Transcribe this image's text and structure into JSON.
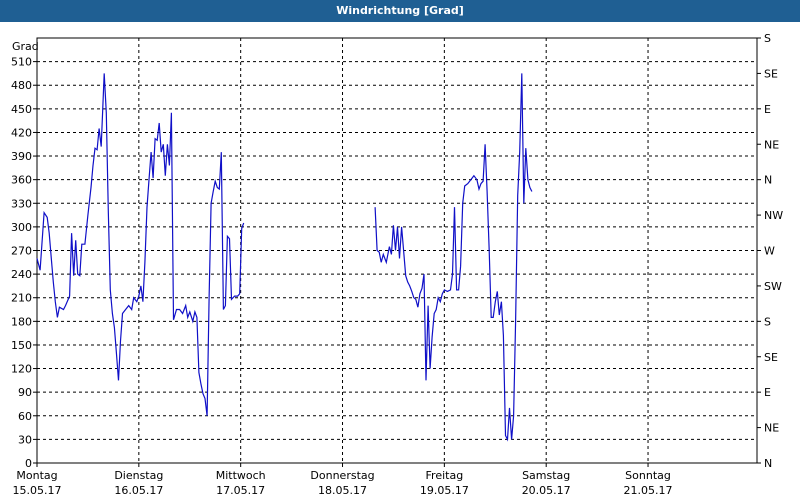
{
  "window": {
    "title": "Windrichtung [Grad]"
  },
  "chart_data": {
    "type": "line",
    "title": "Windrichtung [Grad]",
    "ylabel": "Grad",
    "ylim": [
      0,
      540
    ],
    "y_ticks": [
      0,
      30,
      60,
      90,
      120,
      150,
      180,
      210,
      240,
      270,
      300,
      330,
      360,
      390,
      420,
      450,
      480,
      510
    ],
    "right_axis_ticks": [
      {
        "value": 0,
        "label": "N"
      },
      {
        "value": 45,
        "label": "NE"
      },
      {
        "value": 90,
        "label": "E"
      },
      {
        "value": 135,
        "label": "SE"
      },
      {
        "value": 180,
        "label": "S"
      },
      {
        "value": 225,
        "label": "SW"
      },
      {
        "value": 270,
        "label": "W"
      },
      {
        "value": 315,
        "label": "NW"
      },
      {
        "value": 360,
        "label": "N"
      },
      {
        "value": 405,
        "label": "NE"
      },
      {
        "value": 450,
        "label": "E"
      },
      {
        "value": 495,
        "label": "SE"
      },
      {
        "value": 540,
        "label": "S"
      }
    ],
    "x_range": [
      0,
      7.07
    ],
    "x_ticks": [
      {
        "day": 0,
        "weekday": "Montag",
        "date": "15.05.17"
      },
      {
        "day": 1,
        "weekday": "Dienstag",
        "date": "16.05.17"
      },
      {
        "day": 2,
        "weekday": "Mittwoch",
        "date": "17.05.17"
      },
      {
        "day": 3,
        "weekday": "Donnerstag",
        "date": "18.05.17"
      },
      {
        "day": 4,
        "weekday": "Freitag",
        "date": "19.05.17"
      },
      {
        "day": 5,
        "weekday": "Samstag",
        "date": "20.05.17"
      },
      {
        "day": 6,
        "weekday": "Sonntag",
        "date": "21.05.17"
      }
    ],
    "grid": true,
    "series": [
      {
        "color": "#1010c8",
        "segments": [
          [
            [
              0.0,
              260
            ],
            [
              0.03,
              245
            ],
            [
              0.07,
              318
            ],
            [
              0.1,
              312
            ],
            [
              0.12,
              292
            ],
            [
              0.14,
              260
            ],
            [
              0.16,
              230
            ],
            [
              0.18,
              205
            ],
            [
              0.2,
              185
            ],
            [
              0.22,
              198
            ],
            [
              0.26,
              195
            ],
            [
              0.28,
              200
            ],
            [
              0.32,
              212
            ],
            [
              0.34,
              292
            ],
            [
              0.36,
              238
            ],
            [
              0.38,
              283
            ],
            [
              0.4,
              240
            ],
            [
              0.42,
              238
            ],
            [
              0.44,
              278
            ],
            [
              0.47,
              278
            ],
            [
              0.5,
              315
            ],
            [
              0.53,
              350
            ],
            [
              0.55,
              378
            ],
            [
              0.57,
              400
            ],
            [
              0.59,
              398
            ],
            [
              0.61,
              425
            ],
            [
              0.63,
              402
            ],
            [
              0.66,
              495
            ],
            [
              0.68,
              445
            ],
            [
              0.7,
              320
            ],
            [
              0.72,
              220
            ],
            [
              0.74,
              190
            ],
            [
              0.76,
              172
            ],
            [
              0.78,
              140
            ],
            [
              0.8,
              105
            ],
            [
              0.82,
              155
            ],
            [
              0.84,
              190
            ],
            [
              0.87,
              195
            ],
            [
              0.9,
              200
            ],
            [
              0.93,
              195
            ],
            [
              0.95,
              210
            ],
            [
              0.98,
              205
            ],
            [
              1.0,
              212
            ],
            [
              1.02,
              225
            ],
            [
              1.04,
              205
            ],
            [
              1.06,
              255
            ],
            [
              1.08,
              325
            ],
            [
              1.1,
              360
            ],
            [
              1.12,
              395
            ],
            [
              1.14,
              362
            ],
            [
              1.16,
              412
            ],
            [
              1.18,
              410
            ],
            [
              1.2,
              432
            ],
            [
              1.22,
              395
            ],
            [
              1.24,
              405
            ],
            [
              1.26,
              365
            ],
            [
              1.28,
              405
            ],
            [
              1.3,
              378
            ],
            [
              1.32,
              445
            ],
            [
              1.34,
              182
            ],
            [
              1.37,
              195
            ],
            [
              1.4,
              195
            ],
            [
              1.43,
              190
            ],
            [
              1.46,
              200
            ],
            [
              1.48,
              185
            ],
            [
              1.5,
              192
            ],
            [
              1.53,
              180
            ],
            [
              1.55,
              192
            ],
            [
              1.57,
              185
            ],
            [
              1.59,
              115
            ],
            [
              1.61,
              100
            ],
            [
              1.63,
              88
            ],
            [
              1.65,
              82
            ],
            [
              1.67,
              60
            ],
            [
              1.69,
              210
            ],
            [
              1.71,
              330
            ],
            [
              1.73,
              345
            ],
            [
              1.75,
              358
            ],
            [
              1.77,
              350
            ],
            [
              1.79,
              348
            ],
            [
              1.81,
              395
            ],
            [
              1.83,
              195
            ],
            [
              1.85,
              200
            ],
            [
              1.87,
              288
            ],
            [
              1.89,
              285
            ],
            [
              1.91,
              208
            ],
            [
              1.94,
              212
            ],
            [
              1.97,
              212
            ],
            [
              1.99,
              215
            ],
            [
              2.01,
              298
            ],
            [
              2.03,
              305
            ]
          ],
          [
            [
              3.32,
              325
            ],
            [
              3.34,
              270
            ],
            [
              3.36,
              268
            ],
            [
              3.38,
              255
            ],
            [
              3.4,
              265
            ],
            [
              3.43,
              255
            ],
            [
              3.46,
              275
            ],
            [
              3.48,
              265
            ],
            [
              3.5,
              302
            ],
            [
              3.52,
              270
            ],
            [
              3.54,
              300
            ],
            [
              3.56,
              260
            ],
            [
              3.58,
              300
            ],
            [
              3.6,
              270
            ],
            [
              3.62,
              238
            ],
            [
              3.64,
              230
            ],
            [
              3.66,
              225
            ],
            [
              3.68,
              218
            ],
            [
              3.7,
              210
            ],
            [
              3.72,
              208
            ],
            [
              3.74,
              198
            ],
            [
              3.76,
              215
            ],
            [
              3.78,
              222
            ],
            [
              3.8,
              240
            ],
            [
              3.82,
              105
            ],
            [
              3.84,
              200
            ],
            [
              3.86,
              120
            ],
            [
              3.88,
              160
            ],
            [
              3.9,
              190
            ],
            [
              3.92,
              195
            ],
            [
              3.94,
              210
            ],
            [
              3.96,
              205
            ],
            [
              3.98,
              215
            ],
            [
              4.0,
              220
            ],
            [
              4.03,
              218
            ],
            [
              4.06,
              220
            ],
            [
              4.08,
              240
            ],
            [
              4.1,
              325
            ],
            [
              4.12,
              220
            ],
            [
              4.14,
              220
            ],
            [
              4.16,
              250
            ],
            [
              4.18,
              330
            ],
            [
              4.2,
              352
            ],
            [
              4.23,
              355
            ],
            [
              4.26,
              360
            ],
            [
              4.29,
              365
            ],
            [
              4.32,
              360
            ],
            [
              4.34,
              348
            ],
            [
              4.36,
              355
            ],
            [
              4.38,
              358
            ],
            [
              4.4,
              405
            ],
            [
              4.42,
              345
            ],
            [
              4.44,
              270
            ],
            [
              4.46,
              185
            ],
            [
              4.48,
              185
            ],
            [
              4.5,
              205
            ],
            [
              4.52,
              218
            ],
            [
              4.54,
              188
            ],
            [
              4.56,
              205
            ],
            [
              4.58,
              162
            ],
            [
              4.6,
              35
            ],
            [
              4.62,
              30
            ],
            [
              4.64,
              70
            ],
            [
              4.66,
              30
            ],
            [
              4.68,
              60
            ],
            [
              4.7,
              180
            ],
            [
              4.72,
              340
            ],
            [
              4.74,
              395
            ],
            [
              4.76,
              495
            ],
            [
              4.78,
              330
            ],
            [
              4.8,
              400
            ],
            [
              4.82,
              360
            ],
            [
              4.84,
              350
            ],
            [
              4.86,
              345
            ]
          ]
        ]
      }
    ]
  }
}
